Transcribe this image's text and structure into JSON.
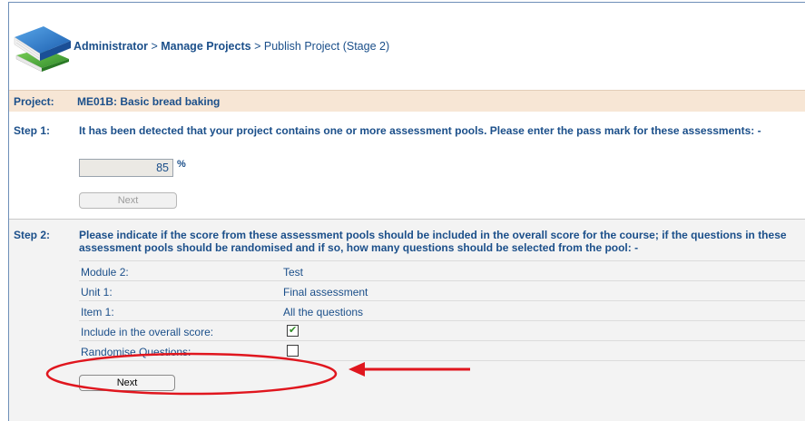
{
  "breadcrumb": {
    "root": "Administrator",
    "sep1": ">",
    "section": "Manage Projects",
    "sep2": ">",
    "current": "Publish Project (Stage 2)"
  },
  "project": {
    "label": "Project:",
    "value": "ME01B: Basic bread baking"
  },
  "step1": {
    "label": "Step 1:",
    "text": "It has been detected that your project contains one or more assessment pools. Please enter the pass mark for these assessments: -",
    "pass_mark": "85",
    "unit": "%",
    "next_label": "Next"
  },
  "step2": {
    "label": "Step 2:",
    "text": "Please indicate if the score from these assessment pools should be included in the overall score for the course; if the questions in these assessment pools should be randomised and if so, how many questions should be selected from the pool: -",
    "rows": [
      {
        "key": "Module 2:",
        "value": "Test"
      },
      {
        "key": "Unit 1:",
        "value": "Final assessment"
      },
      {
        "key": "Item 1:",
        "value": "All the questions"
      }
    ],
    "include_label": "Include in the overall score:",
    "include_checked": true,
    "randomise_label": "Randomise Questions:",
    "randomise_checked": false,
    "next_label": "Next"
  },
  "colors": {
    "text": "#1b4f8a",
    "project_bar": "#f7e6d5",
    "annotation": "#e0161e"
  },
  "icons": {
    "logo": "books-logo-icon"
  }
}
